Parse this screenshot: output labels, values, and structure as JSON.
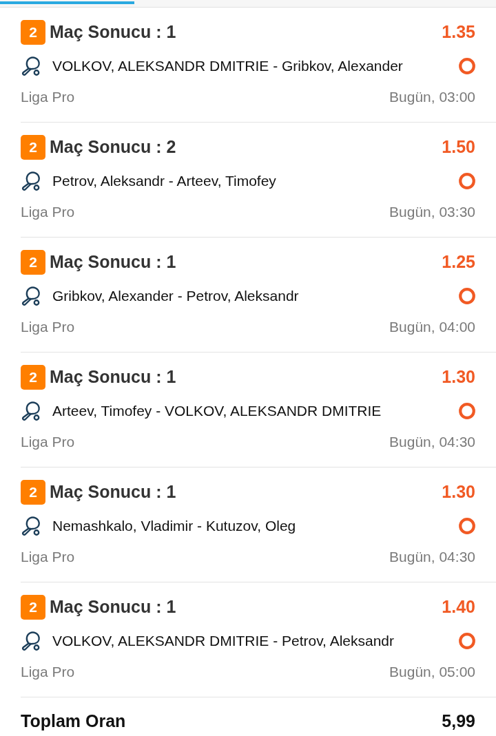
{
  "bets": [
    {
      "badge": "2",
      "market": "Maç Sonucu : 1",
      "odds": "1.35",
      "match": "VOLKOV, ALEKSANDR DMITRIE - Gribkov, Alexander",
      "league": "Liga Pro",
      "time": "Bugün, 03:00"
    },
    {
      "badge": "2",
      "market": "Maç Sonucu : 2",
      "odds": "1.50",
      "match": "Petrov, Aleksandr - Arteev, Timofey",
      "league": "Liga Pro",
      "time": "Bugün, 03:30"
    },
    {
      "badge": "2",
      "market": "Maç Sonucu : 1",
      "odds": "1.25",
      "match": "Gribkov, Alexander - Petrov, Aleksandr",
      "league": "Liga Pro",
      "time": "Bugün, 04:00"
    },
    {
      "badge": "2",
      "market": "Maç Sonucu : 1",
      "odds": "1.30",
      "match": "Arteev, Timofey - VOLKOV, ALEKSANDR DMITRIE",
      "league": "Liga Pro",
      "time": "Bugün, 04:30"
    },
    {
      "badge": "2",
      "market": "Maç Sonucu : 1",
      "odds": "1.30",
      "match": "Nemashkalo, Vladimir - Kutuzov, Oleg",
      "league": "Liga Pro",
      "time": "Bugün, 04:30"
    },
    {
      "badge": "2",
      "market": "Maç Sonucu : 1",
      "odds": "1.40",
      "match": "VOLKOV, ALEKSANDR DMITRIE - Petrov, Aleksandr",
      "league": "Liga Pro",
      "time": "Bugün, 05:00"
    }
  ],
  "total": {
    "label": "Toplam Oran",
    "value": "5,99"
  }
}
